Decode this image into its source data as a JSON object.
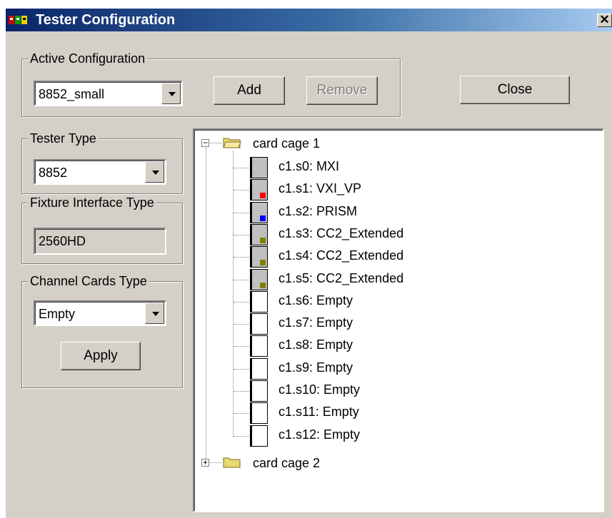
{
  "window": {
    "title": "Tester Configuration",
    "close_glyph": "✕"
  },
  "active_config": {
    "legend": "Active Configuration",
    "selected": "8852_small",
    "add_label": "Add",
    "remove_label": "Remove"
  },
  "close_label": "Close",
  "tester_type": {
    "legend": "Tester Type",
    "selected": "8852"
  },
  "fixture_interface": {
    "legend": "Fixture Interface Type",
    "value": "2560HD"
  },
  "channel_cards": {
    "legend": "Channel Cards Type",
    "selected": "Empty",
    "apply_label": "Apply"
  },
  "tree": {
    "cage1": {
      "label": "card cage 1",
      "expanded": true,
      "slots": [
        {
          "label": "c1.s0: MXI",
          "filled": true,
          "mark_color": ""
        },
        {
          "label": "c1.s1: VXI_VP",
          "filled": true,
          "mark_color": "#ff0000"
        },
        {
          "label": "c1.s2: PRISM",
          "filled": true,
          "mark_color": "#0000ff"
        },
        {
          "label": "c1.s3: CC2_Extended",
          "filled": true,
          "mark_color": "#808000"
        },
        {
          "label": "c1.s4: CC2_Extended",
          "filled": true,
          "mark_color": "#808000"
        },
        {
          "label": "c1.s5: CC2_Extended",
          "filled": true,
          "mark_color": "#808000"
        },
        {
          "label": "c1.s6: Empty",
          "filled": false,
          "mark_color": ""
        },
        {
          "label": "c1.s7: Empty",
          "filled": false,
          "mark_color": ""
        },
        {
          "label": "c1.s8: Empty",
          "filled": false,
          "mark_color": ""
        },
        {
          "label": "c1.s9: Empty",
          "filled": false,
          "mark_color": ""
        },
        {
          "label": "c1.s10: Empty",
          "filled": false,
          "mark_color": ""
        },
        {
          "label": "c1.s11: Empty",
          "filled": false,
          "mark_color": ""
        },
        {
          "label": "c1.s12: Empty",
          "filled": false,
          "mark_color": ""
        }
      ]
    },
    "cage2": {
      "label": "card cage 2",
      "expanded": false
    }
  },
  "colors": {
    "titlebar_start": "#0a246a",
    "dialog_bg": "#d4d0c8",
    "folder": "#e8d870"
  }
}
